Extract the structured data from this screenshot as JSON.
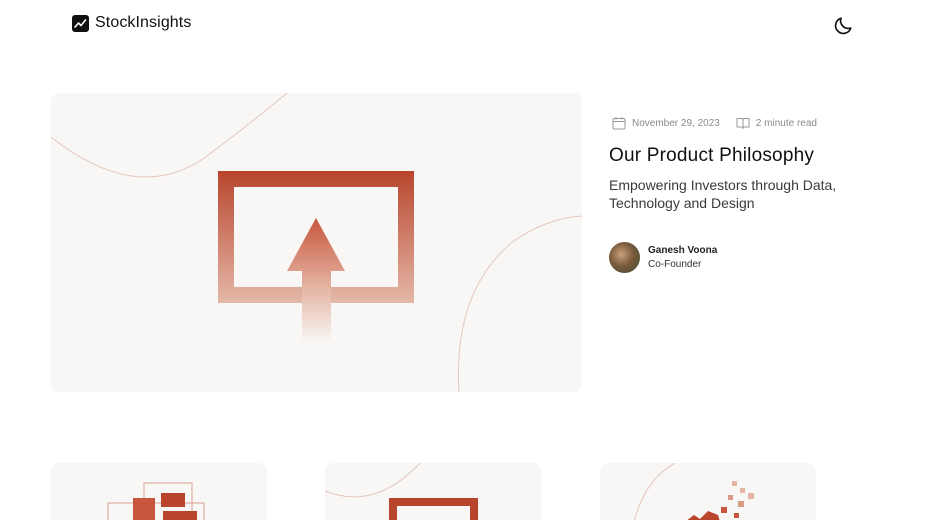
{
  "header": {
    "brand": "StockInsights",
    "logo_icon": "chart-trend-icon",
    "theme_icon": "moon-icon"
  },
  "featured": {
    "date": "November 29, 2023",
    "date_icon": "calendar-icon",
    "read_time": "2 minute read",
    "read_icon": "book-open-icon",
    "title": "Our Product Philosophy",
    "subtitle": "Empowering Investors through Data, Technology and Design",
    "author": {
      "name": "Ganesh Voona",
      "role": "Co-Founder"
    },
    "image_icon": "upload-arrow-illustration"
  },
  "colors": {
    "accent": "#b8452c",
    "card_bg": "#f8f7f6",
    "meta_text": "#8a8a8a"
  }
}
